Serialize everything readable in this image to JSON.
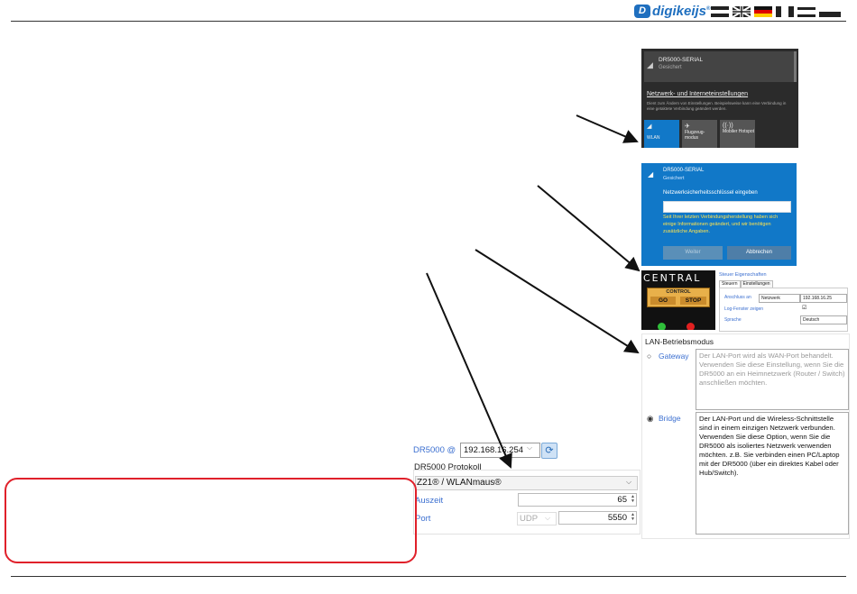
{
  "header": {
    "brand": "digikeijs",
    "brand_mark": "D",
    "registered": "®",
    "colors": {
      "rule": "#333333",
      "brand": "#1f6fbf",
      "highlight": "#e0202a"
    }
  },
  "wifi_list": {
    "network_name": "DR5000-SERIAL",
    "network_status": "Gesichert",
    "settings_link": "Netzwerk- und Interneteinstellungen",
    "settings_desc": "Dient zum Ändern von Einstellungen. Beispielsweise kann eine Verbindung in eine getaktete Verbindung geändert werden.",
    "tiles": [
      {
        "label": "WLAN",
        "icon": "wifi-icon"
      },
      {
        "label": "Flugzeug-modus",
        "icon": "airplane-icon"
      },
      {
        "label": "Mobiler Hotspot",
        "icon": "hotspot-icon"
      }
    ]
  },
  "wifi_connect": {
    "network_name": "DR5000-SERIAL",
    "network_status": "Gesichert",
    "key_label": "Netzwerksicherheitsschlüssel eingeben",
    "key_value": "",
    "warning": "Seit Ihrer letzten Verbindungsherstellung haben sich einige Informationen geändert, und wir benötigen zusätzliche Angaben.",
    "next_button": "Weiter",
    "cancel_button": "Abbrechen"
  },
  "central": {
    "title": "CENTRAL",
    "control_label": "CONTROL",
    "go_label": "GO",
    "stop_label": "STOP"
  },
  "steuer_props": {
    "title": "Steuer Eigenschaften",
    "tabs": [
      "Steuern",
      "Einstellungen"
    ],
    "rows": [
      {
        "label": "Anschluss an",
        "value": "Netzwerk",
        "value2": "192.168.16.25"
      },
      {
        "label": "Log-Fenster zeigen",
        "value": "☑"
      },
      {
        "label": "Sprache",
        "value": "Deutsch"
      }
    ]
  },
  "lan_mode": {
    "title": "LAN-Betriebsmodus",
    "gateway_label": "Gateway",
    "gateway_desc": "Der LAN-Port wird als WAN-Port behandelt. Verwenden Sie diese Einstellung, wenn Sie die DR5000 an ein Heimnetzwerk (Router / Switch) anschließen möchten.",
    "bridge_label": "Bridge",
    "bridge_desc": "Der LAN-Port und die Wireless-Schnittstelle sind in einem einzigen Netzwerk verbunden. Verwenden Sie diese Option, wenn Sie die DR5000 als isoliertes Netzwerk verwenden möchten. z.B. Sie verbinden einen PC/Laptop mit der DR5000 (über ein direktes Kabel oder Hub/Switch).",
    "selected": "Bridge"
  },
  "dr5000": {
    "label": "DR5000 @",
    "ip": "192.168.16.254",
    "protocol_title": "DR5000 Protokoll",
    "protocol": "Z21® / WLANmaus®",
    "timeout_label": "Auszeit",
    "timeout_value": "65",
    "port_label": "Port",
    "port_type": "UDP",
    "port_value": "5550"
  }
}
